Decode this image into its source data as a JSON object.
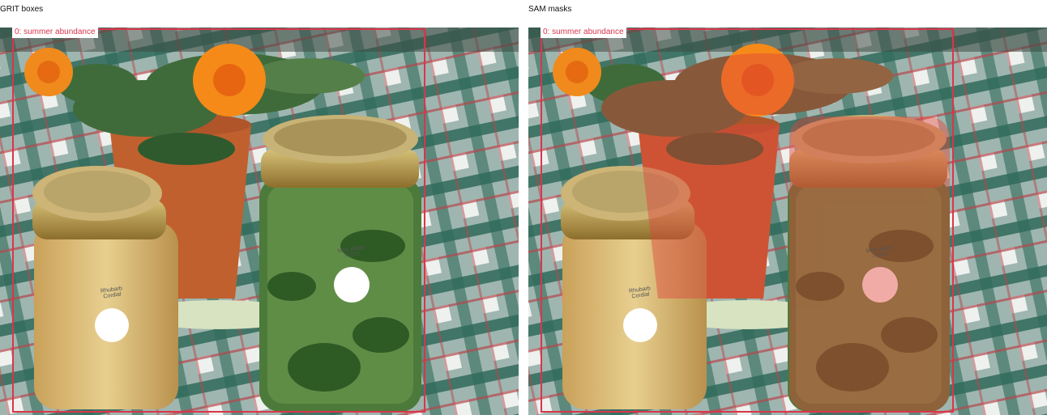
{
  "panels": [
    {
      "title": "GRIT boxes",
      "mask": false
    },
    {
      "title": "SAM masks",
      "mask": true
    }
  ],
  "detections": [
    {
      "label": "0: summer abundance"
    }
  ],
  "jar_labels": {
    "small_jar": "Rhubarb Cordial",
    "tall_jar": "Mint Water 7/2/12"
  },
  "colors": {
    "box": "#d9364b",
    "mask": "#e0443c"
  }
}
